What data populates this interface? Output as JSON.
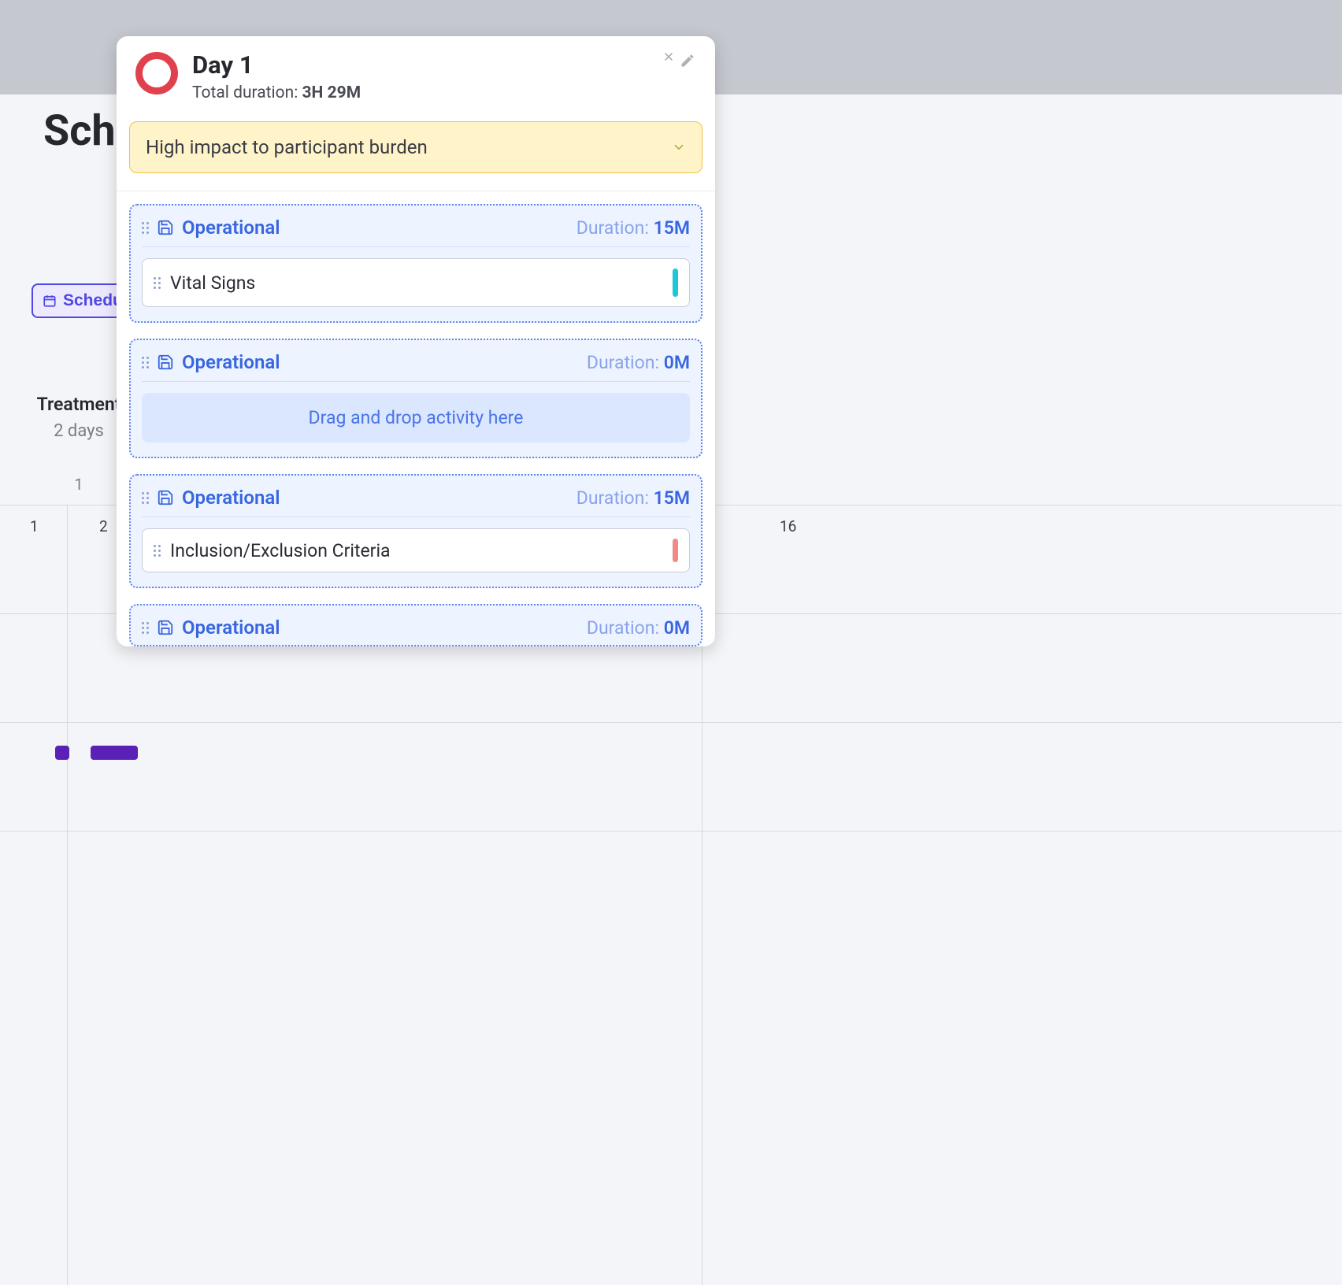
{
  "background": {
    "heading_fragment": "Sch",
    "schedule_button": "Schedul",
    "column": {
      "title": "Treatment",
      "subtitle": "2 days",
      "sub_number": "1"
    },
    "cells": {
      "a": "1",
      "b": "2",
      "c": "16"
    }
  },
  "panel": {
    "title": "Day 1",
    "duration_label": "Total duration: ",
    "duration_value": "3H 29M",
    "alert": "High impact to participant burden",
    "blocks": [
      {
        "category": "Operational",
        "duration_label": "Duration: ",
        "duration_value": "15M",
        "activity": "Vital Signs",
        "marker": "teal"
      },
      {
        "category": "Operational",
        "duration_label": "Duration: ",
        "duration_value": "0M",
        "dropzone": "Drag and drop activity here"
      },
      {
        "category": "Operational",
        "duration_label": "Duration: ",
        "duration_value": "15M",
        "activity": "Inclusion/Exclusion Criteria",
        "marker": "coral"
      },
      {
        "category": "Operational",
        "duration_label": "Duration: ",
        "duration_value": "0M"
      }
    ]
  }
}
